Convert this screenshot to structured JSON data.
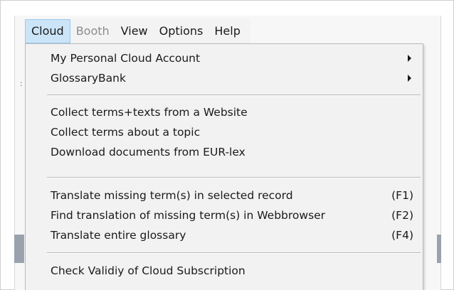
{
  "menubar": {
    "items": [
      {
        "label": "Cloud",
        "state": "active"
      },
      {
        "label": "Booth",
        "state": "disabled"
      },
      {
        "label": "View",
        "state": "normal"
      },
      {
        "label": "Options",
        "state": "normal"
      },
      {
        "label": "Help",
        "state": "normal"
      }
    ]
  },
  "dropdown": {
    "items": [
      {
        "label": "My Personal Cloud Account",
        "submenu": true,
        "shortcut": ""
      },
      {
        "label": "GlossaryBank",
        "submenu": true,
        "shortcut": ""
      },
      {
        "label": "Collect terms+texts from a Website",
        "submenu": false,
        "shortcut": ""
      },
      {
        "label": "Collect terms about a topic",
        "submenu": false,
        "shortcut": ""
      },
      {
        "label": "Download documents from EUR-lex",
        "submenu": false,
        "shortcut": ""
      },
      {
        "label": "Translate missing term(s) in selected record",
        "submenu": false,
        "shortcut": "(F1)"
      },
      {
        "label": "Find translation of missing term(s) in Webbrowser",
        "submenu": false,
        "shortcut": "(F2)"
      },
      {
        "label": "Translate entire glossary",
        "submenu": false,
        "shortcut": "(F4)"
      },
      {
        "label": "Check Validiy of Cloud Subscription",
        "submenu": false,
        "shortcut": ""
      }
    ]
  },
  "background": {
    "tick_glyph": ":"
  },
  "colors": {
    "menubar_bg": "#f3f3f3",
    "active_highlight": "#cce4f7",
    "active_border": "#99c9ef",
    "dropdown_bg": "#f2f2f2",
    "disabled_text": "#8c8c8c"
  }
}
